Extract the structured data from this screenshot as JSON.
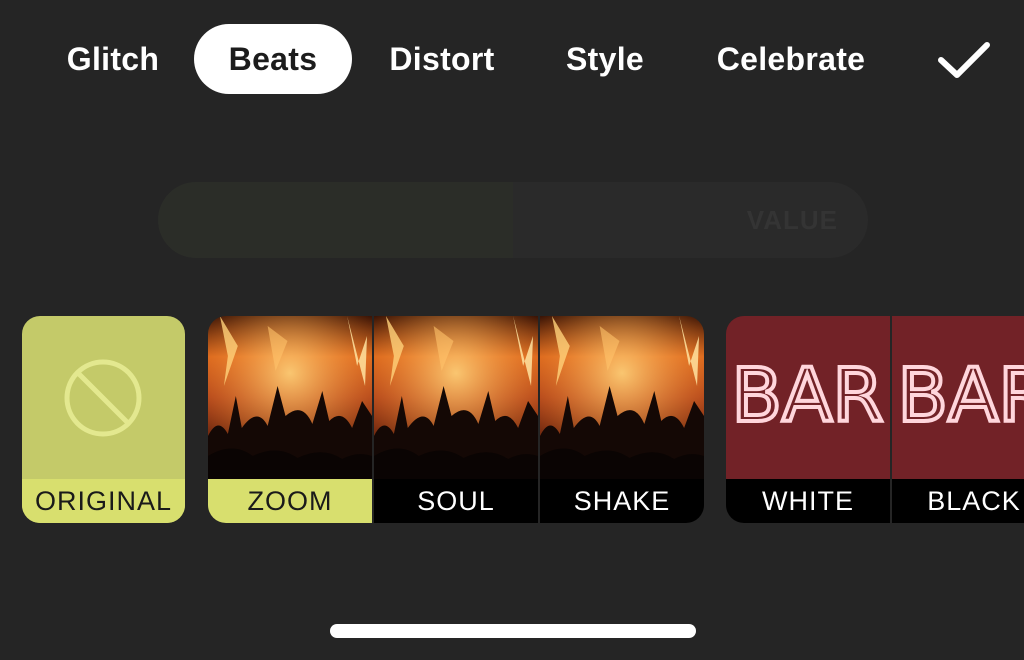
{
  "tabs": [
    {
      "label": "Glitch"
    },
    {
      "label": "Beats",
      "active": true
    },
    {
      "label": "Distort"
    },
    {
      "label": "Style"
    },
    {
      "label": "Celebrate"
    }
  ],
  "confirm_icon": "checkmark-icon",
  "slider": {
    "label": "VALUE",
    "fill_fraction": 0.5
  },
  "effects": [
    {
      "label": "ORIGINAL",
      "icon": "no-effect-icon",
      "selected": true
    },
    {
      "label": "ZOOM",
      "thumbnail": "concert-crowd-fire",
      "selected": true
    },
    {
      "label": "SOUL",
      "thumbnail": "concert-crowd-fire"
    },
    {
      "label": "SHAKE",
      "thumbnail": "concert-crowd-fire"
    },
    {
      "label": "WHITE",
      "thumbnail": "neon-bar-sign"
    },
    {
      "label": "BLACK",
      "thumbnail": "neon-bar-sign"
    }
  ],
  "neon_sign_text": "BAR",
  "colors": {
    "background": "#252525",
    "accent": "#d8df6e",
    "original_card": "#c4ca69"
  }
}
